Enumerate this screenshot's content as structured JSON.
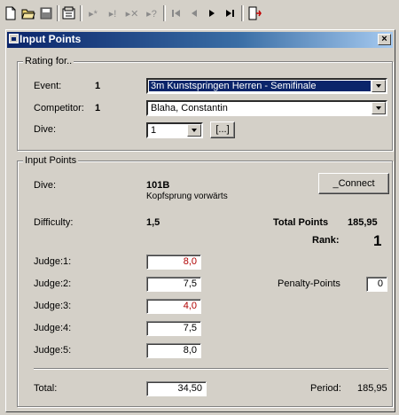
{
  "toolbar": {
    "icons": [
      "new-document-icon",
      "open-folder-icon",
      "save-icon",
      "properties-icon",
      "insert-record-icon",
      "next-new-icon",
      "delete-record-icon",
      "help-record-icon",
      "first-record-icon",
      "previous-record-icon",
      "next-record-icon",
      "last-record-icon",
      "exit-icon"
    ]
  },
  "window": {
    "title": "Input Points",
    "close_glyph": "×"
  },
  "rating": {
    "legend": "Rating for..",
    "event_label": "Event:",
    "event_num": "1",
    "event_value": "3m Kunstspringen Herren - Semifinale",
    "competitor_label": "Competitor:",
    "competitor_num": "1",
    "competitor_value": "Blaha, Constantin",
    "dive_label": "Dive:",
    "dive_value": "1",
    "browse_button": "[...]"
  },
  "input": {
    "legend": "Input Points",
    "dive_label": "Dive:",
    "dive_code": "101B",
    "dive_name": "Kopfsprung vorwärts",
    "connect_button": "_Connect",
    "difficulty_label": "Difficulty:",
    "difficulty_value": "1,5",
    "total_points_label": "Total Points",
    "total_points_value": "185,95",
    "rank_label": "Rank:",
    "rank_value": "1",
    "judges": [
      {
        "label": "Judge:1:",
        "value": "8,0",
        "color": "#b00000"
      },
      {
        "label": "Judge:2:",
        "value": "7,5",
        "color": "#000000"
      },
      {
        "label": "Judge:3:",
        "value": "4,0",
        "color": "#b00000"
      },
      {
        "label": "Judge:4:",
        "value": "7,5",
        "color": "#000000"
      },
      {
        "label": "Judge:5:",
        "value": "8,0",
        "color": "#000000"
      }
    ],
    "penalty_label": "Penalty-Points",
    "penalty_value": "0",
    "total_label": "Total:",
    "total_value": "34,50",
    "period_label": "Period:",
    "period_value": "185,95"
  }
}
